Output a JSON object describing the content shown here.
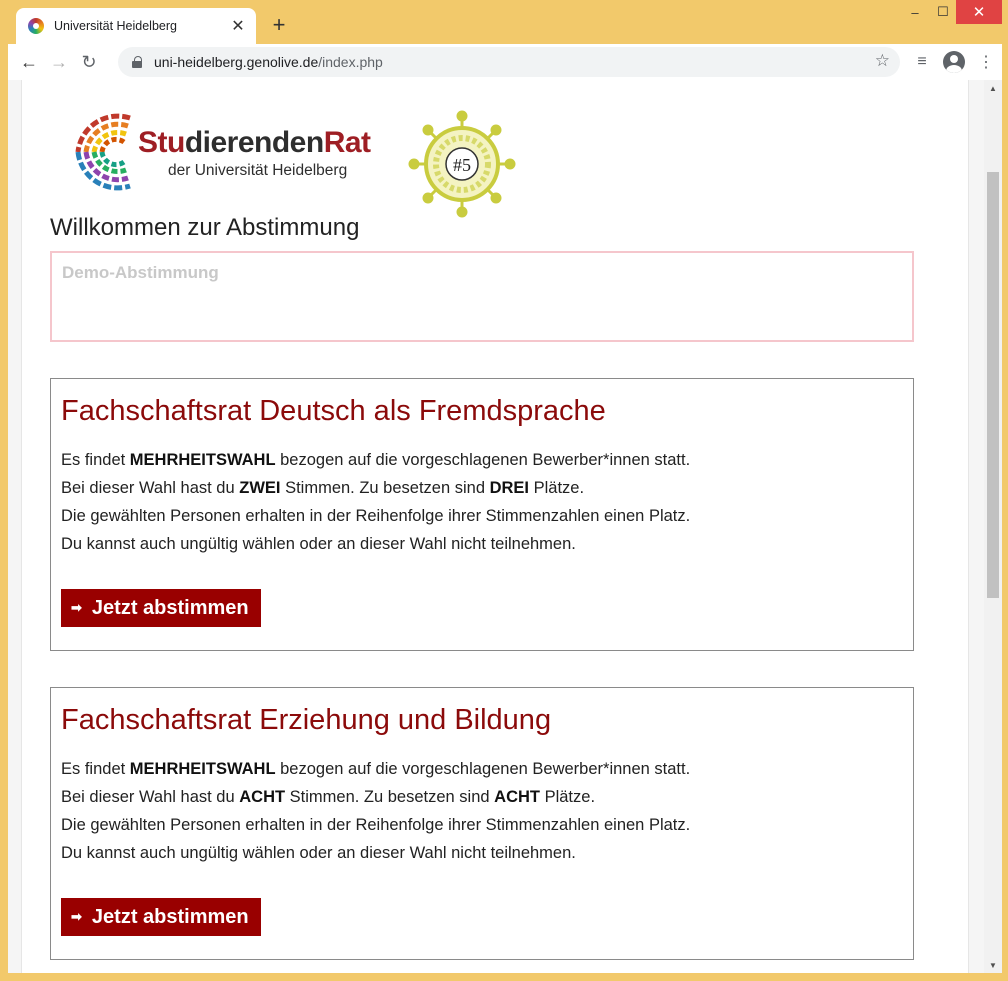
{
  "browser": {
    "tab_title": "Universität Heidelberg",
    "tab_close_icon": "close-icon",
    "new_tab_icon": "plus-icon",
    "url_host": "uni-heidelberg.genolive.de",
    "url_path": "/index.php",
    "window_controls": [
      "minimize",
      "maximize",
      "close"
    ]
  },
  "logo": {
    "title_red": "Stu",
    "title_dark_1": "dierenden",
    "title_red_2": "Rat",
    "subtitle": "der Universität Heidelberg",
    "badge_text": "#5"
  },
  "page": {
    "welcome": "Willkommen zur Abstimmung",
    "demo_label": "Demo-Abstimmung"
  },
  "elections": [
    {
      "title": "Fachschaftsrat Deutsch als Fremdsprache",
      "line1_pre": "Es findet ",
      "line1_bold": "MEHRHEITSWAHL",
      "line1_post": " bezogen auf die vorgeschlagenen Bewerber*innen statt.",
      "line2_pre": "Bei dieser Wahl hast du ",
      "line2_bold1": "ZWEI",
      "line2_mid": " Stimmen. Zu besetzen sind ",
      "line2_bold2": "DREI",
      "line2_post": " Plätze.",
      "line3": "Die gewählten Personen erhalten in der Reihenfolge ihrer Stimmenzahlen einen Platz.",
      "line4": "Du kannst auch ungültig wählen oder an dieser Wahl nicht teilnehmen.",
      "button": "Jetzt abstimmen"
    },
    {
      "title": "Fachschaftsrat Erziehung und Bildung",
      "line1_pre": "Es findet ",
      "line1_bold": "MEHRHEITSWAHL",
      "line1_post": " bezogen auf die vorgeschlagenen Bewerber*innen statt.",
      "line2_pre": "Bei dieser Wahl hast du ",
      "line2_bold1": "ACHT",
      "line2_mid": " Stimmen. Zu besetzen sind ",
      "line2_bold2": "ACHT",
      "line2_post": " Plätze.",
      "line3": "Die gewählten Personen erhalten in der Reihenfolge ihrer Stimmenzahlen einen Platz.",
      "line4": "Du kannst auch ungültig wählen oder an dieser Wahl nicht teilnehmen.",
      "button": "Jetzt abstimmen"
    }
  ],
  "colors": {
    "frame": "#f2c96b",
    "title_red": "#8b0a0a",
    "button_bg": "#990000",
    "demo_border": "#f5c6cc"
  }
}
